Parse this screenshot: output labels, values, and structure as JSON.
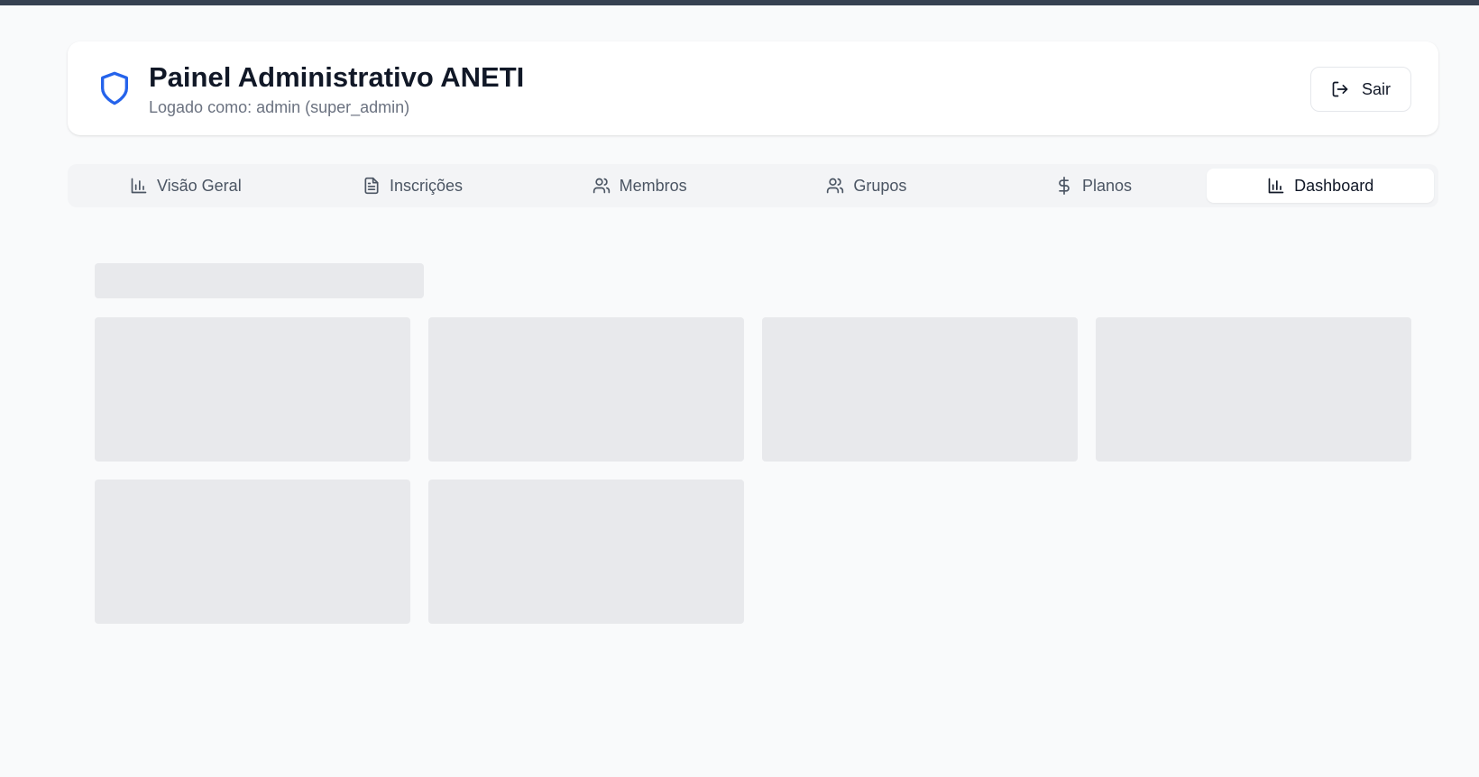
{
  "header": {
    "title": "Painel Administrativo ANETI",
    "subtitle": "Logado como: admin (super_admin)",
    "logout_label": "Sair",
    "icon": "shield-icon"
  },
  "tabs": [
    {
      "label": "Visão Geral",
      "icon": "bar-chart-icon",
      "active": false
    },
    {
      "label": "Inscrições",
      "icon": "file-text-icon",
      "active": false
    },
    {
      "label": "Membros",
      "icon": "users-icon",
      "active": false
    },
    {
      "label": "Grupos",
      "icon": "users-icon",
      "active": false
    },
    {
      "label": "Planos",
      "icon": "dollar-sign-icon",
      "active": false
    },
    {
      "label": "Dashboard",
      "icon": "bar-chart-icon",
      "active": true
    }
  ],
  "colors": {
    "accent": "#2563eb",
    "background": "#f9fafb",
    "skeleton": "#e8e9ec"
  },
  "loading_state": "skeleton"
}
